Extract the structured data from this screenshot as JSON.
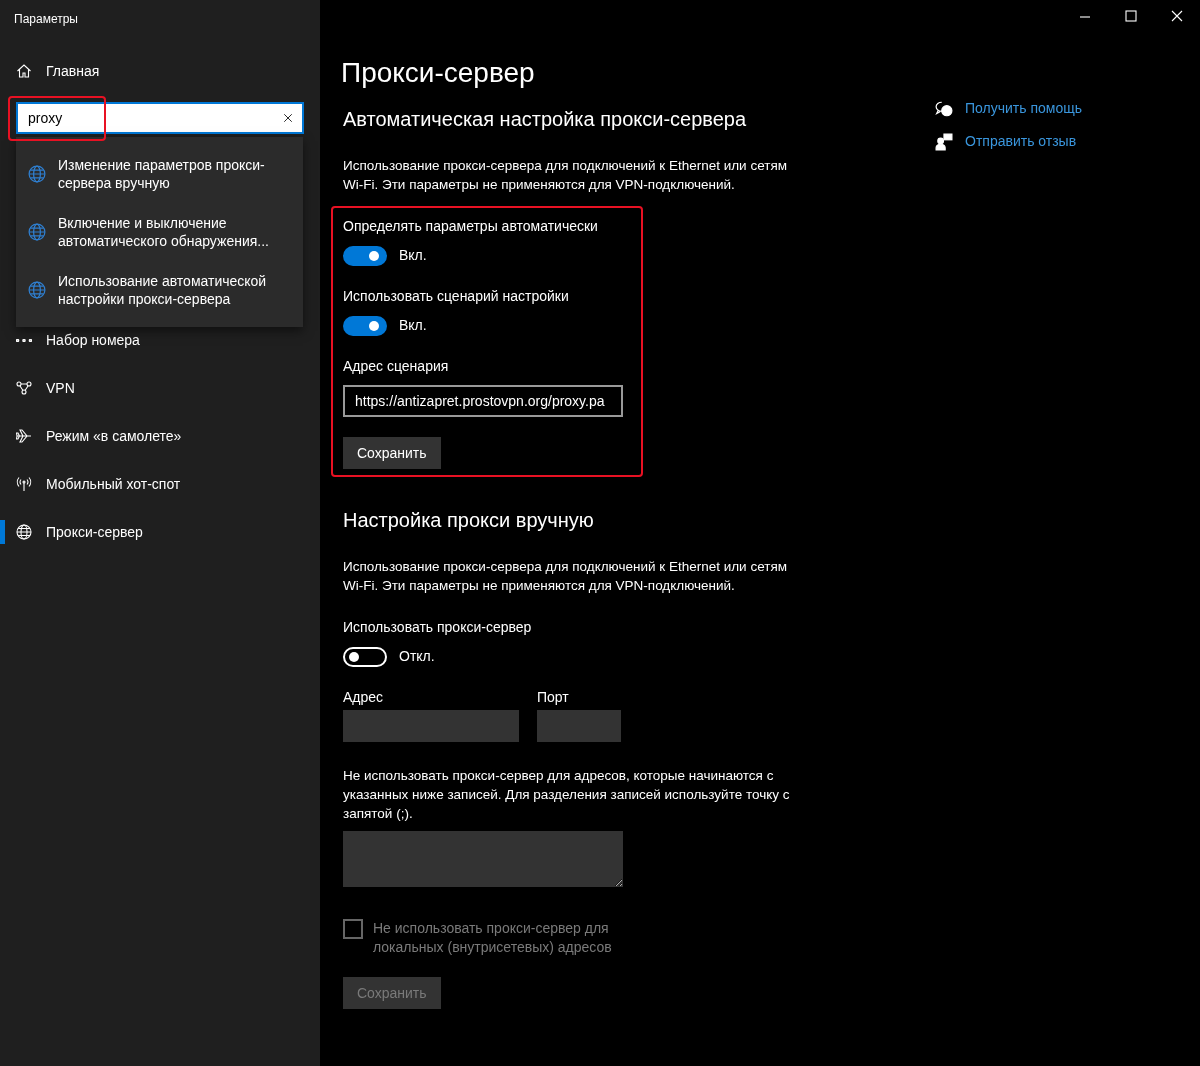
{
  "window": {
    "title": "Параметры"
  },
  "sidebar": {
    "home": "Главная",
    "search": {
      "value": "proxy",
      "highlighted": true
    },
    "suggestions": [
      {
        "text": "Изменение параметров прокси-сервера вручную"
      },
      {
        "text": "Включение и выключение автоматического обнаружения..."
      },
      {
        "text": "Использование автоматической настройки прокси-сервера"
      }
    ],
    "items": [
      {
        "label": "Набор номера",
        "selected": false
      },
      {
        "label": "VPN",
        "selected": false
      },
      {
        "label": "Режим «в самолете»",
        "selected": false
      },
      {
        "label": "Мобильный хот-спот",
        "selected": false
      },
      {
        "label": "Прокси-сервер",
        "selected": true
      }
    ]
  },
  "page": {
    "title": "Прокси-сервер",
    "sections": [
      {
        "heading": "Автоматическая настройка прокси-сервера",
        "description": "Использование прокси-сервера для подключений к Ethernet или сетям Wi-Fi. Эти параметры не применяются для VPN-подключений.",
        "highlighted": true,
        "settings": [
          {
            "kind": "toggle",
            "label": "Определять параметры автоматически",
            "on": true,
            "state_text": "Вкл."
          },
          {
            "kind": "toggle",
            "label": "Использовать сценарий настройки",
            "on": true,
            "state_text": "Вкл."
          },
          {
            "kind": "field",
            "label": "Адрес сценария",
            "value": "https://antizapret.prostovpn.org/proxy.pa",
            "disabled": false
          },
          {
            "kind": "button",
            "label": "Сохранить",
            "disabled": false
          }
        ]
      },
      {
        "heading": "Настройка прокси вручную",
        "description": "Использование прокси-сервера для подключений к Ethernet или сетям Wi-Fi. Эти параметры не применяются для VPN-подключений.",
        "highlighted": false,
        "settings": [
          {
            "kind": "toggle",
            "label": "Использовать прокси-сервер",
            "on": false,
            "state_text": "Откл."
          },
          {
            "kind": "address_port",
            "address_label": "Адрес",
            "port_label": "Порт",
            "disabled": true
          },
          {
            "kind": "textarea",
            "label": "Не использовать прокси-сервер для адресов, которые начинаются с указанных ниже записей. Для разделения записей используйте точку с запятой (;).",
            "disabled": true
          },
          {
            "kind": "checkbox",
            "label": "Не использовать прокси-сервер для локальных (внутрисетевых) адресов",
            "checked": false,
            "disabled": true
          },
          {
            "kind": "button",
            "label": "Сохранить",
            "disabled": true
          }
        ]
      }
    ]
  },
  "help": [
    {
      "label": "Получить помощь"
    },
    {
      "label": "Отправить отзыв"
    }
  ]
}
